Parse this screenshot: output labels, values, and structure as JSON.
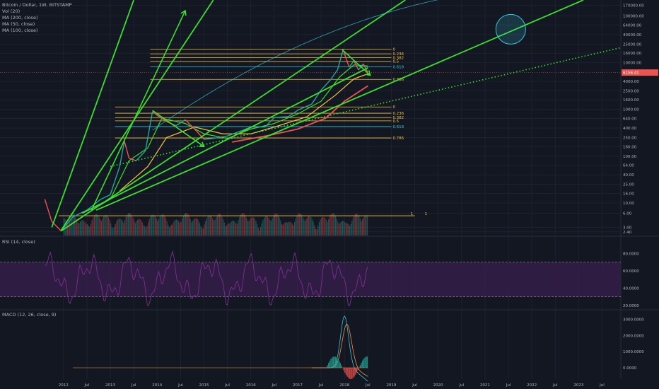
{
  "legend": {
    "title": "Bitcoin / Dollar, 1W, BITSTAMP",
    "lines": [
      "Vol (20)",
      "MA (200, close)",
      "MA (50, close)",
      "MA (100, close)"
    ]
  },
  "rsi_label": "RSI (14, close)",
  "macd_label": "MACD (12, 26, close, 9)",
  "colors": {
    "background": "#131722",
    "up": "#26a69a",
    "down": "#ef5350",
    "trendline": "#3cde2f",
    "fib": "#f5c242",
    "fib618": "#36c5d6",
    "rsi": "#7b2f8f",
    "price_badge": "#ef5350"
  },
  "price_badge": "6156.41",
  "chart_data": [
    {
      "type": "line",
      "title": "Bitcoin / Dollar, 1W, BITSTAMP",
      "scale": "log",
      "x_ticks": [
        "2012",
        "Jul",
        "2013",
        "Jul",
        "2014",
        "Jul",
        "2015",
        "Jul",
        "2016",
        "Jul",
        "2017",
        "Jul",
        "2018",
        "Jul",
        "2019",
        "Jul",
        "2020",
        "Jul",
        "2021",
        "Jul",
        "2022",
        "Jul",
        "2023",
        "Jul"
      ],
      "y_ticks": [
        "170000.00",
        "100000.00",
        "64000.00",
        "40000.00",
        "25000.00",
        "16000.00",
        "10000.00",
        "6156.41",
        "4000.00",
        "2500.00",
        "1600.00",
        "1000.00",
        "640.00",
        "400.00",
        "250.00",
        "160.00",
        "100.00",
        "64.00",
        "40.00",
        "25.00",
        "16.00",
        "10.00",
        "6.00",
        "3.00",
        "2.40"
      ],
      "last_price": 6156.41,
      "fib_high_set": [
        "0",
        "0.236",
        "0.382",
        "0.5",
        "0.618",
        "0.786"
      ],
      "fib_low_set": [
        "0",
        "0.236",
        "0.382",
        "0.5",
        "0.618",
        "0.786"
      ],
      "volume_fib": [
        "1",
        "1"
      ],
      "series": [
        {
          "name": "MA (200, close)"
        },
        {
          "name": "MA (50, close)"
        },
        {
          "name": "MA (100, close)"
        }
      ],
      "price_path": [
        [
          2011.6,
          12
        ],
        [
          2011.75,
          4
        ],
        [
          2011.95,
          2.5
        ],
        [
          2012.2,
          5
        ],
        [
          2012.5,
          7
        ],
        [
          2012.8,
          12
        ],
        [
          2013.0,
          15
        ],
        [
          2013.2,
          60
        ],
        [
          2013.3,
          210
        ],
        [
          2013.4,
          90
        ],
        [
          2013.55,
          80
        ],
        [
          2013.75,
          130
        ],
        [
          2013.9,
          900
        ],
        [
          2014.0,
          750
        ],
        [
          2014.2,
          550
        ],
        [
          2014.4,
          450
        ],
        [
          2014.6,
          600
        ],
        [
          2014.8,
          380
        ],
        [
          2015.0,
          230
        ],
        [
          2015.2,
          240
        ],
        [
          2015.5,
          270
        ],
        [
          2015.8,
          350
        ],
        [
          2016.0,
          420
        ],
        [
          2016.3,
          420
        ],
        [
          2016.5,
          670
        ],
        [
          2016.8,
          700
        ],
        [
          2017.0,
          960
        ],
        [
          2017.3,
          1300
        ],
        [
          2017.5,
          2600
        ],
        [
          2017.7,
          4300
        ],
        [
          2017.85,
          7000
        ],
        [
          2017.97,
          19000
        ],
        [
          2018.1,
          8000
        ],
        [
          2018.2,
          11000
        ],
        [
          2018.3,
          7000
        ],
        [
          2018.4,
          9500
        ],
        [
          2018.5,
          6156
        ]
      ],
      "ma50_path": [
        [
          2012.6,
          7
        ],
        [
          2013.0,
          12
        ],
        [
          2013.4,
          80
        ],
        [
          2013.8,
          150
        ],
        [
          2014.1,
          650
        ],
        [
          2014.6,
          500
        ],
        [
          2015.0,
          300
        ],
        [
          2015.5,
          240
        ],
        [
          2016.0,
          380
        ],
        [
          2016.5,
          500
        ],
        [
          2017.0,
          800
        ],
        [
          2017.5,
          1500
        ],
        [
          2017.9,
          5000
        ],
        [
          2018.2,
          9000
        ],
        [
          2018.5,
          8500
        ]
      ],
      "ma100_path": [
        [
          2013.2,
          18
        ],
        [
          2013.8,
          60
        ],
        [
          2014.2,
          250
        ],
        [
          2014.8,
          420
        ],
        [
          2015.4,
          300
        ],
        [
          2016.0,
          300
        ],
        [
          2016.6,
          450
        ],
        [
          2017.2,
          700
        ],
        [
          2017.8,
          2000
        ],
        [
          2018.2,
          4500
        ],
        [
          2018.5,
          5800
        ]
      ],
      "ma200_path": [
        [
          2015.6,
          200
        ],
        [
          2016.4,
          280
        ],
        [
          2017.0,
          380
        ],
        [
          2017.6,
          650
        ],
        [
          2018.0,
          1500
        ],
        [
          2018.5,
          3200
        ]
      ],
      "rsi": {
        "y_ticks": [
          "80.0000",
          "60.0000",
          "40.0000",
          "20.0000"
        ],
        "upper": 70,
        "lower": 30
      },
      "macd": {
        "y_ticks": [
          "3000.0000",
          "2000.0000",
          "1000.0000",
          "0.0000"
        ]
      }
    }
  ]
}
